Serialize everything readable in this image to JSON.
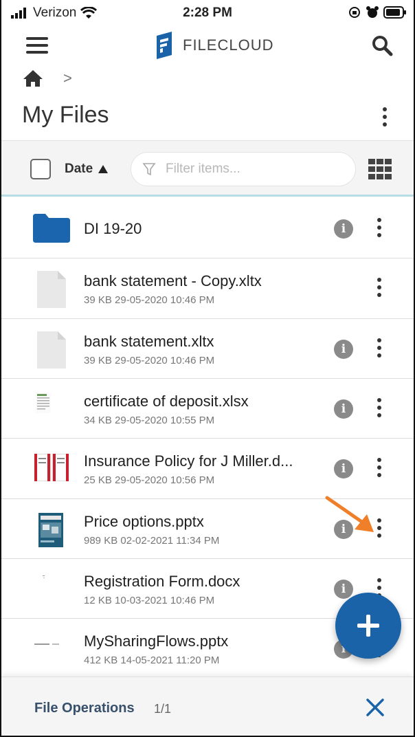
{
  "status_bar": {
    "carrier": "Verizon",
    "time": "2:28 PM"
  },
  "app": {
    "logo_text": "FILECLOUD",
    "brand_color": "#1a63a8"
  },
  "breadcrumb": {
    "home_icon": "home-icon",
    "separator": ">"
  },
  "page": {
    "title": "My Files"
  },
  "toolbar": {
    "sort_label": "Date",
    "sort_direction": "ascending",
    "filter_placeholder": "Filter items..."
  },
  "files": [
    {
      "name": "DI 19-20",
      "meta": "",
      "type": "folder",
      "show_info": true
    },
    {
      "name": "bank statement - Copy.xltx",
      "meta": "39 KB 29-05-2020 10:46 PM",
      "type": "generic",
      "show_info": false
    },
    {
      "name": "bank statement.xltx",
      "meta": "39 KB 29-05-2020 10:46 PM",
      "type": "generic",
      "show_info": true
    },
    {
      "name": "certificate of deposit.xlsx",
      "meta": "34 KB 29-05-2020 10:55 PM",
      "type": "spreadsheet",
      "show_info": true
    },
    {
      "name": "Insurance Policy for J Miller.d...",
      "meta": "25 KB 29-05-2020 10:56 PM",
      "type": "document",
      "show_info": true
    },
    {
      "name": "Price options.pptx",
      "meta": "989 KB 02-02-2021 11:34 PM",
      "type": "presentation",
      "show_info": true
    },
    {
      "name": "Registration Form.docx",
      "meta": "12 KB 10-03-2021 10:46 PM",
      "type": "doc-blank",
      "show_info": true
    },
    {
      "name": "MySharingFlows.pptx",
      "meta": "412 KB 14-05-2021 11:20 PM",
      "type": "slide-blank",
      "show_info": true
    }
  ],
  "file_operations": {
    "label": "File Operations",
    "count": "1/1"
  }
}
